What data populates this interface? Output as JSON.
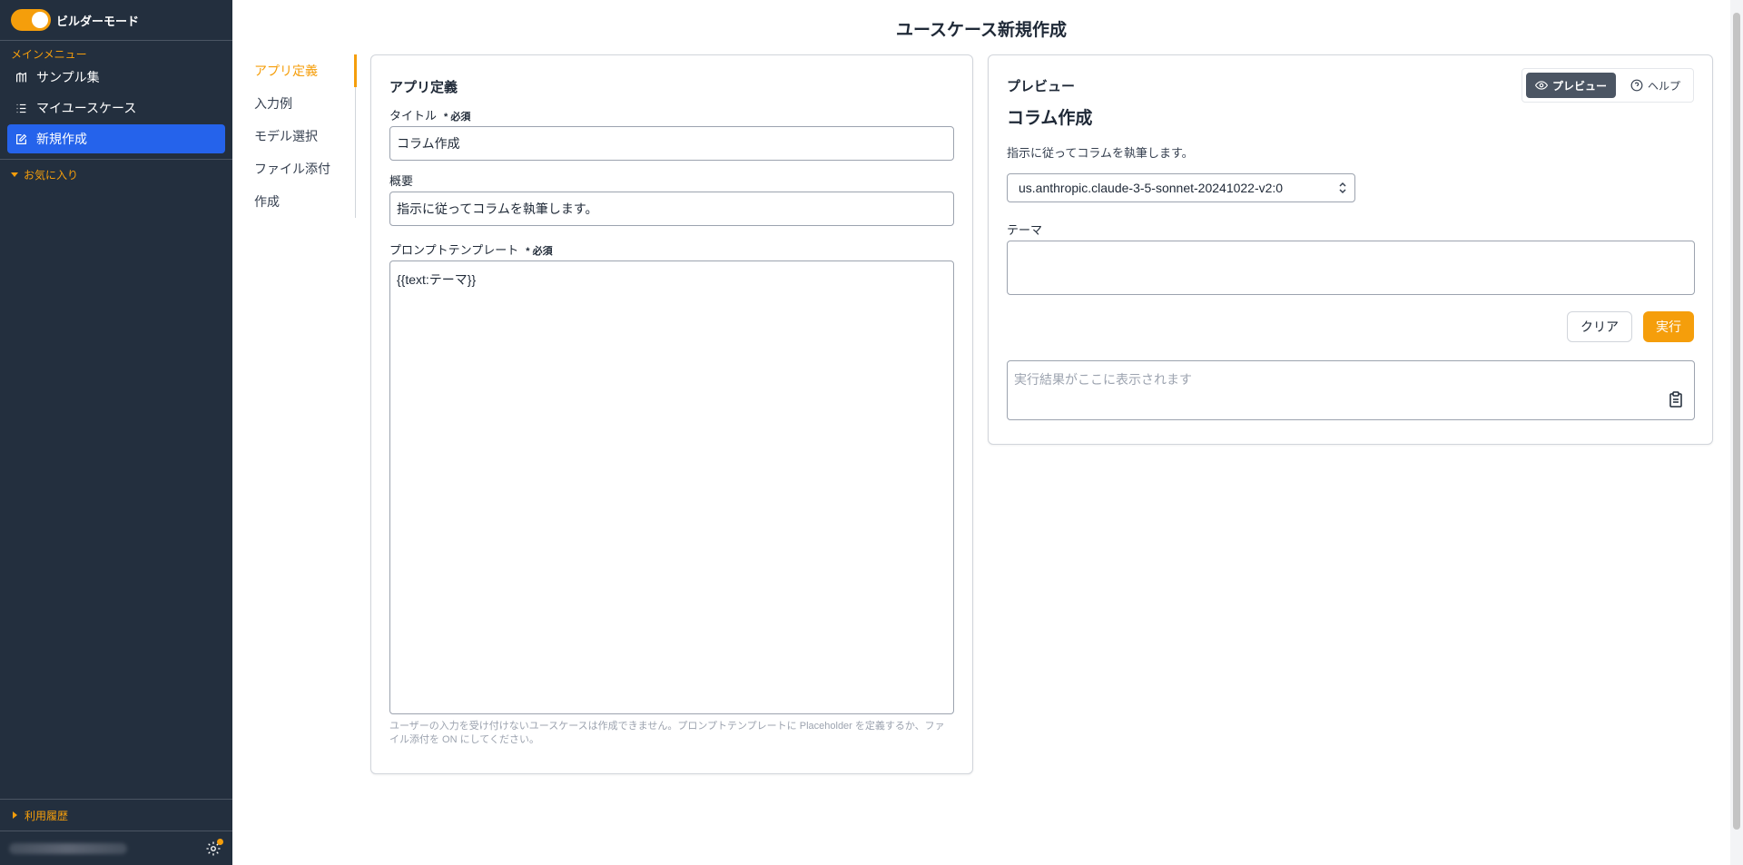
{
  "sidebar": {
    "builder_mode_label": "ビルダーモード",
    "main_menu_title": "メインメニュー",
    "items": [
      {
        "label": "サンプル集",
        "icon": "book-icon"
      },
      {
        "label": "マイユースケース",
        "icon": "list-icon"
      },
      {
        "label": "新規作成",
        "icon": "edit-icon"
      }
    ],
    "favorites_label": "お気に入り",
    "history_label": "利用履歴",
    "user_name": ""
  },
  "page": {
    "title": "ユースケース新規作成"
  },
  "subnav": [
    "アプリ定義",
    "入力例",
    "モデル選択",
    "ファイル添付",
    "作成"
  ],
  "definition": {
    "header": "アプリ定義",
    "title_label": "タイトル",
    "required_mark": "* 必須",
    "title_value": "コラム作成",
    "summary_label": "概要",
    "summary_value": "指示に従ってコラムを執筆します。",
    "prompt_label": "プロンプトテンプレート",
    "prompt_value": "{{text:テーマ}}",
    "hint": "ユーザーの入力を受け付けないユースケースは作成できません。プロンプトテンプレートに Placeholder を定義するか、ファイル添付を ON にしてください。"
  },
  "preview": {
    "header": "プレビュー",
    "tab_preview": "プレビュー",
    "tab_help": "ヘルプ",
    "title": "コラム作成",
    "description": "指示に従ってコラムを執筆します。",
    "model": "us.anthropic.claude-3-5-sonnet-20241022-v2:0",
    "theme_label": "テーマ",
    "clear_label": "クリア",
    "run_label": "実行",
    "result_placeholder": "実行結果がここに表示されます"
  },
  "colors": {
    "accent": "#f59e0b",
    "sidebar_bg": "#232f3e",
    "active_item": "#2563eb"
  }
}
